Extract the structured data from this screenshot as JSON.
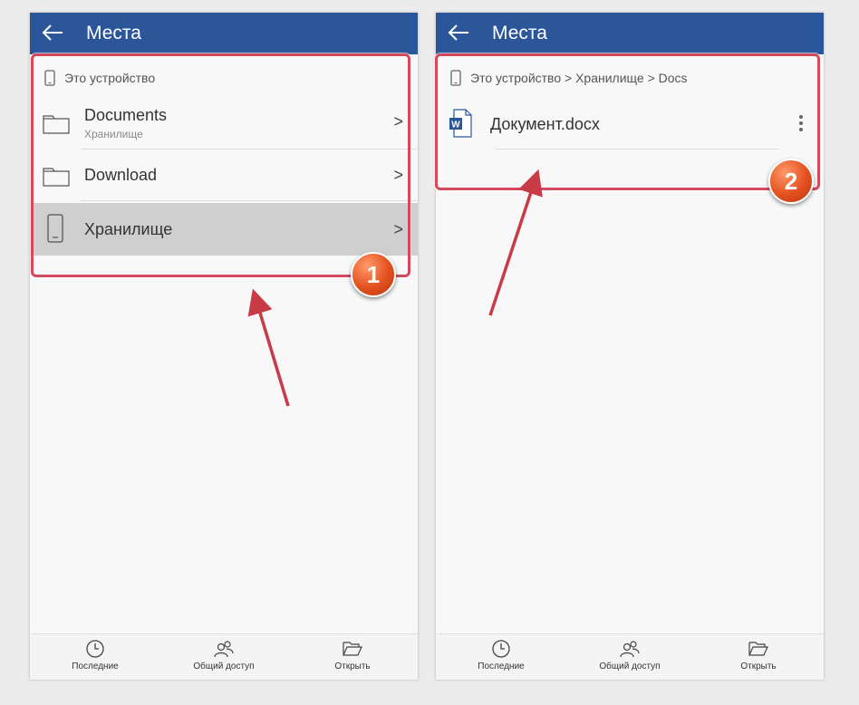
{
  "left_screen": {
    "title": "Места",
    "breadcrumb": "Это устройство",
    "items": [
      {
        "label": "Documents",
        "sublabel": "Хранилище",
        "icon": "folder-icon",
        "chevron": ">"
      },
      {
        "label": "Download",
        "icon": "folder-icon",
        "chevron": ">"
      },
      {
        "label": "Хранилище",
        "icon": "phone-icon",
        "chevron": ">",
        "selected": true
      }
    ],
    "badge": "1"
  },
  "right_screen": {
    "title": "Места",
    "breadcrumb": "Это устройство > Хранилище > Docs",
    "items": [
      {
        "label": "Документ.docx",
        "icon": "word-document-icon",
        "menu_icon": "more-vertical-icon"
      }
    ],
    "badge": "2"
  },
  "bottom_nav": [
    {
      "label": "Последние",
      "icon": "clock-icon"
    },
    {
      "label": "Общий доступ",
      "icon": "people-icon"
    },
    {
      "label": "Открыть",
      "icon": "open-folder-icon"
    }
  ],
  "colors": {
    "appbar": "#2b579a",
    "highlight": "#d44a5c",
    "badge": "#e4501f",
    "selected_row": "#cfcfcf"
  }
}
